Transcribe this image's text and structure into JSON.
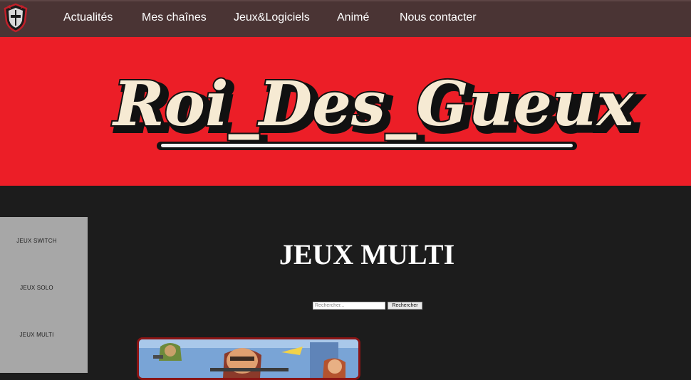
{
  "nav": {
    "items": [
      {
        "label": "Actualités"
      },
      {
        "label": "Mes chaînes"
      },
      {
        "label": "Jeux&Logiciels"
      },
      {
        "label": "Animé"
      },
      {
        "label": "Nous contacter"
      }
    ],
    "logo_icon": "knight-helmet-icon"
  },
  "banner": {
    "title": "Roi_Des_Gueux"
  },
  "sidebar": {
    "items": [
      {
        "label": "JEUX SWITCH"
      },
      {
        "label": "JEUX SOLO"
      },
      {
        "label": "JEUX MULTI"
      }
    ]
  },
  "main": {
    "title": "JEUX MULTI",
    "search": {
      "placeholder": "Rechercher...",
      "button_label": "Rechercher"
    }
  },
  "colors": {
    "navbar": "#4a3434",
    "banner": "#ec1e27",
    "page_background": "#1c1c1c",
    "sidebar": "#a7a7a7",
    "card_border": "#8a1414"
  }
}
